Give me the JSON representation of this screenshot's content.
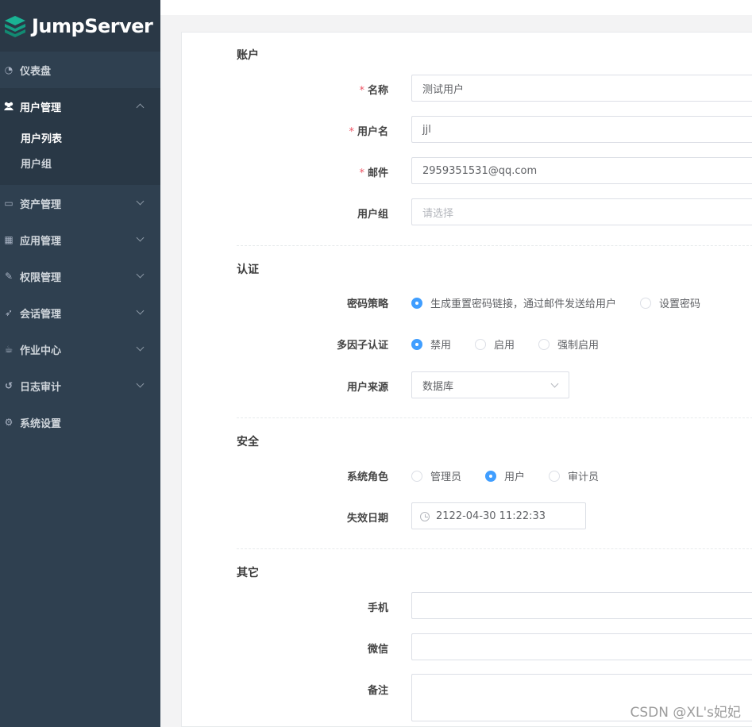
{
  "brand": {
    "name": "JumpServer"
  },
  "sidebar": {
    "items": [
      {
        "label": "仪表盘",
        "icon": "dashboard-icon"
      },
      {
        "label": "用户管理",
        "icon": "users-icon",
        "expanded": true
      },
      {
        "label": "资产管理",
        "icon": "inbox-icon"
      },
      {
        "label": "应用管理",
        "icon": "grid-icon"
      },
      {
        "label": "权限管理",
        "icon": "edit-icon"
      },
      {
        "label": "会话管理",
        "icon": "rocket-icon"
      },
      {
        "label": "作业中心",
        "icon": "coffee-icon"
      },
      {
        "label": "日志审计",
        "icon": "history-icon"
      },
      {
        "label": "系统设置",
        "icon": "gears-icon"
      }
    ],
    "submenu": [
      {
        "label": "用户列表"
      },
      {
        "label": "用户组"
      }
    ]
  },
  "form": {
    "account": {
      "title": "账户",
      "name_label": "名称",
      "name_value": "测试用户",
      "username_label": "用户名",
      "username_value": "jjl",
      "email_label": "邮件",
      "email_value": "2959351531@qq.com",
      "group_label": "用户组",
      "group_placeholder": "请选择"
    },
    "auth": {
      "title": "认证",
      "password_label": "密码策略",
      "password_options": [
        "生成重置密码链接，通过邮件发送给用户",
        "设置密码"
      ],
      "password_selected": 0,
      "mfa_label": "多因子认证",
      "mfa_options": [
        "禁用",
        "启用",
        "强制启用"
      ],
      "mfa_selected": 0,
      "source_label": "用户来源",
      "source_value": "数据库"
    },
    "security": {
      "title": "安全",
      "role_label": "系统角色",
      "role_options": [
        "管理员",
        "用户",
        "审计员"
      ],
      "role_selected": 1,
      "expire_label": "失效日期",
      "expire_value": "2122-04-30 11:22:33"
    },
    "other": {
      "title": "其它",
      "phone_label": "手机",
      "wechat_label": "微信",
      "comment_label": "备注"
    }
  },
  "watermark": "CSDN @XL's妃妃",
  "colors": {
    "sidebar": "#2f4050",
    "primary": "#409eff",
    "required": "#ed5565"
  }
}
